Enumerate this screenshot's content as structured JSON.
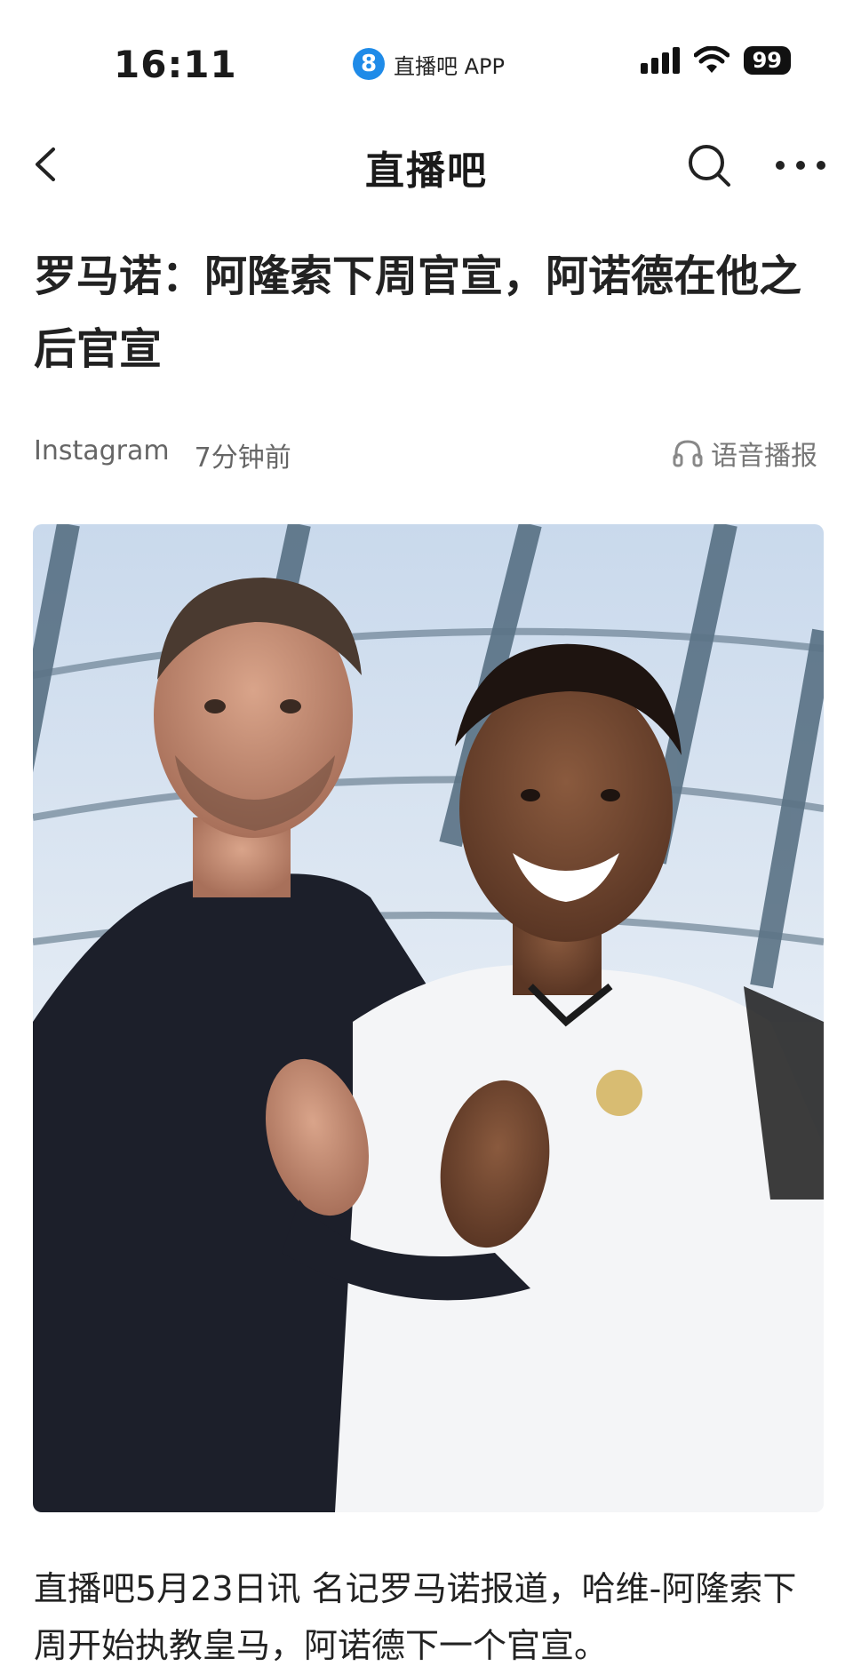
{
  "status_bar": {
    "time": "16:11",
    "app_logo": "8",
    "app_name": "直播吧 APP",
    "battery": "99"
  },
  "nav": {
    "title": "直播吧",
    "back_icon": "chevron-left-icon",
    "search_icon": "search-icon",
    "more_icon": "more-horizontal-icon"
  },
  "article": {
    "title": "罗马诺：阿隆索下周官宣，阿诺德在他之后官宣",
    "source": "Instagram",
    "time_ago": "7分钟前",
    "tts_label": "语音播报",
    "tts_icon": "headphones-icon",
    "body": "直播吧5月23日讯 名记罗马诺报道，哈维-阿隆索下周开始执教皇马，阿诺德下一个官宣。"
  },
  "colors": {
    "accent": "#1f8be8",
    "text": "#222222",
    "meta": "#666666"
  }
}
